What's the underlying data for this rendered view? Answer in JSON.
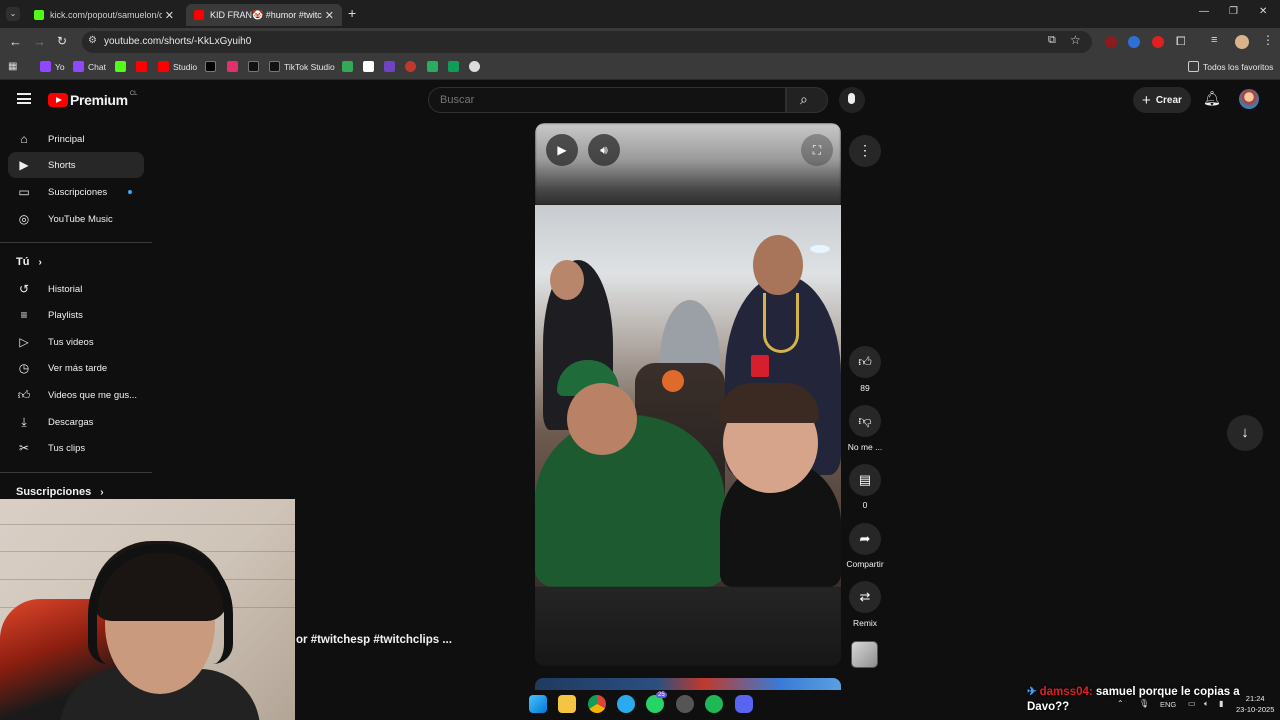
{
  "browser": {
    "tabs": [
      {
        "title": "kick.com/popout/samuelon/cha",
        "favicon_color": "#53fc18",
        "active": false
      },
      {
        "title": "KID FRAN🤡 #humor #twitches",
        "favicon_color": "#ff0000",
        "active": true
      }
    ],
    "new_tab_label": "+",
    "url": "youtube.com/shorts/-KkLxGyuih0",
    "window_controls": [
      "—",
      "❐",
      "✕"
    ],
    "bookmarks": [
      {
        "label": "Yo",
        "icon": "twitch-icon",
        "color": "#9146ff"
      },
      {
        "label": "Chat",
        "icon": "twitch-icon",
        "color": "#9146ff"
      },
      {
        "label": "",
        "icon": "kick-icon",
        "color": "#53fc18"
      },
      {
        "label": "",
        "icon": "youtube-icon",
        "color": "#ff0000"
      },
      {
        "label": "Studio",
        "icon": "youtube-studio-icon",
        "color": "#ff0000"
      },
      {
        "label": "",
        "icon": "x-icon",
        "color": "#000000"
      },
      {
        "label": "",
        "icon": "instagram-icon",
        "color": "#e1306c"
      },
      {
        "label": "",
        "icon": "tiktok-icon",
        "color": "#111111"
      },
      {
        "label": "TikTok Studio",
        "icon": "tiktok-icon",
        "color": "#111111"
      },
      {
        "label": "",
        "icon": "drive-icon",
        "color": "#34a853"
      },
      {
        "label": "",
        "icon": "bookmark-icon",
        "color": "#ffffff"
      },
      {
        "label": "",
        "icon": "bookmark-icon",
        "color": "#6f42c1"
      },
      {
        "label": "",
        "icon": "bookmark-icon",
        "color": "#c0392b"
      },
      {
        "label": "",
        "icon": "bookmark-icon",
        "color": "#27ae60"
      },
      {
        "label": "",
        "icon": "sheets-icon",
        "color": "#0f9d58"
      },
      {
        "label": "",
        "icon": "bookmark-icon",
        "color": "#dddddd"
      }
    ],
    "all_bookmarks_label": "Todos los favoritos"
  },
  "youtube": {
    "logo_word": "Premium",
    "country_code": "CL",
    "search_placeholder": "Buscar",
    "create_label": "Crear",
    "sidebar": {
      "main": [
        {
          "label": "Principal",
          "icon": "home-icon"
        },
        {
          "label": "Shorts",
          "icon": "shorts-icon",
          "active": true
        },
        {
          "label": "Suscripciones",
          "icon": "subscriptions-icon"
        },
        {
          "label": "YouTube Music",
          "icon": "music-icon"
        }
      ],
      "you_heading": "Tú",
      "you_items": [
        {
          "label": "Historial",
          "icon": "history-icon"
        },
        {
          "label": "Playlists",
          "icon": "playlists-icon"
        },
        {
          "label": "Tus videos",
          "icon": "your-videos-icon"
        },
        {
          "label": "Ver más tarde",
          "icon": "watch-later-icon"
        },
        {
          "label": "Videos que me gus...",
          "icon": "liked-icon"
        },
        {
          "label": "Descargas",
          "icon": "download-icon"
        },
        {
          "label": "Tus clips",
          "icon": "clips-icon"
        }
      ],
      "subscriptions_heading": "Suscripciones"
    },
    "short": {
      "caption": "or #twitchesp #twitchclips ...",
      "actions": [
        {
          "label": "89",
          "icon": "like-icon"
        },
        {
          "label": "No me ...",
          "icon": "dislike-icon"
        },
        {
          "label": "0",
          "icon": "comment-icon"
        },
        {
          "label": "Compartir",
          "icon": "share-icon"
        },
        {
          "label": "Remix",
          "icon": "remix-icon"
        }
      ]
    }
  },
  "stream_overlay": {
    "chat_user": "damss04:",
    "chat_message": "samuel porque le copias a Davo??"
  },
  "taskbar": {
    "notification_badge": "25",
    "language": "ENG",
    "time": "21:24",
    "date": "23-10-2025"
  }
}
